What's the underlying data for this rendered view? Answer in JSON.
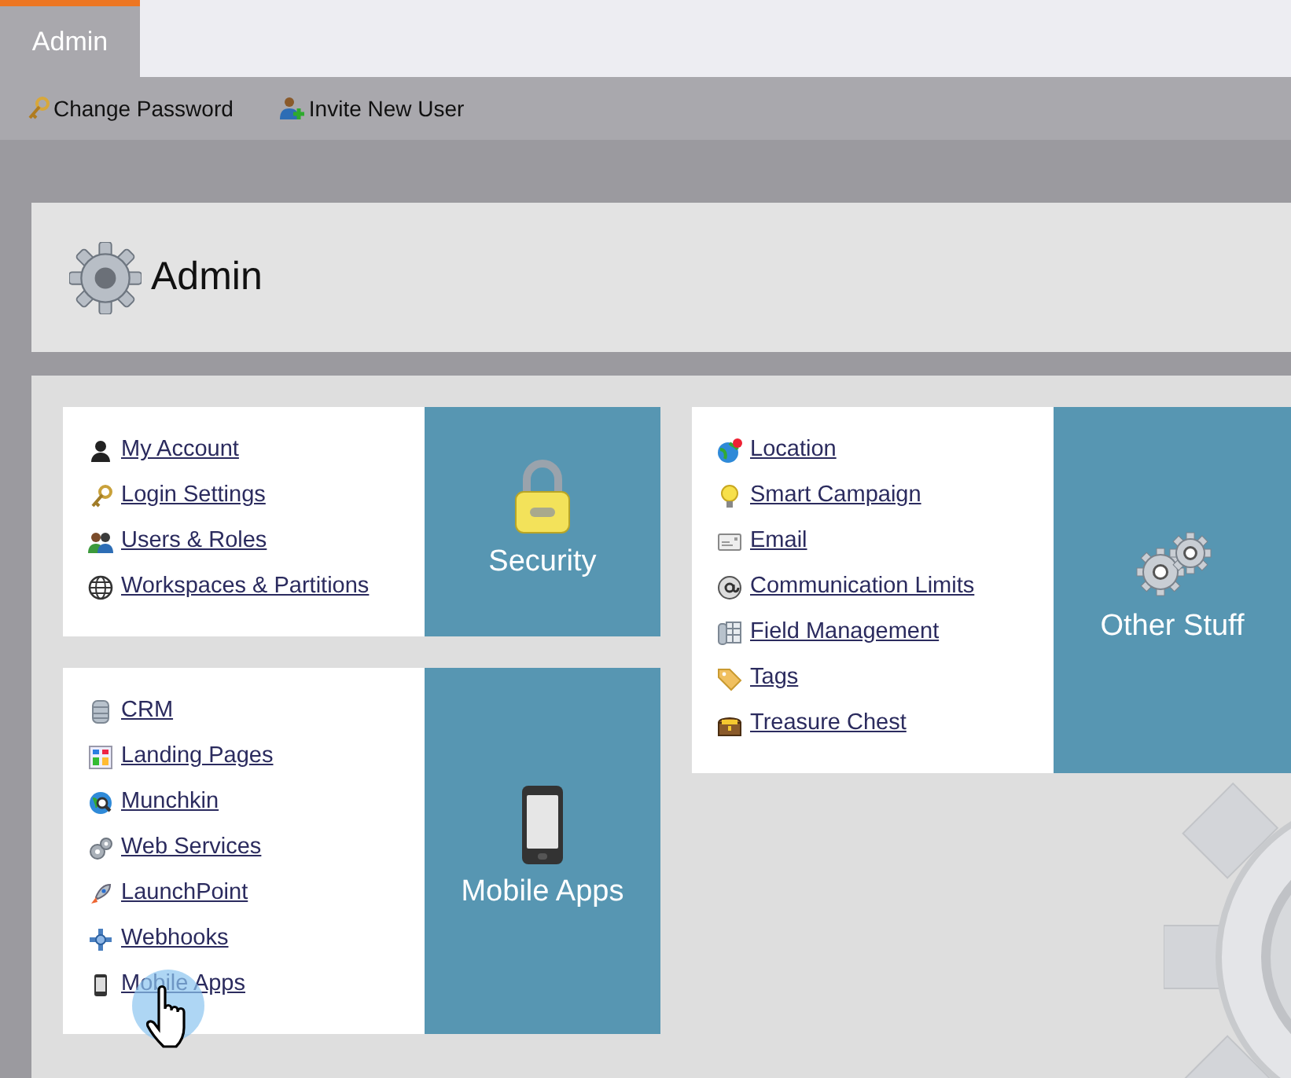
{
  "tabs": [
    {
      "label": "Admin",
      "selected": true
    }
  ],
  "toolbar": [
    {
      "label": "Change Password"
    },
    {
      "label": "Invite New User"
    }
  ],
  "header": {
    "title": "Admin"
  },
  "sections": [
    {
      "title": "Security",
      "items": [
        {
          "label": "My Account"
        },
        {
          "label": "Login Settings"
        },
        {
          "label": "Users & Roles"
        },
        {
          "label": "Workspaces & Partitions"
        }
      ]
    },
    {
      "title": "Mobile Apps",
      "items": [
        {
          "label": "CRM"
        },
        {
          "label": "Landing Pages"
        },
        {
          "label": "Munchkin"
        },
        {
          "label": "Web Services"
        },
        {
          "label": "LaunchPoint"
        },
        {
          "label": "Webhooks"
        },
        {
          "label": "Mobile Apps"
        }
      ]
    },
    {
      "title": "Other Stuff",
      "items": [
        {
          "label": "Location"
        },
        {
          "label": "Smart Campaign"
        },
        {
          "label": "Email"
        },
        {
          "label": "Communication Limits"
        },
        {
          "label": "Field Management"
        },
        {
          "label": "Tags"
        },
        {
          "label": "Treasure Chest"
        }
      ]
    }
  ]
}
